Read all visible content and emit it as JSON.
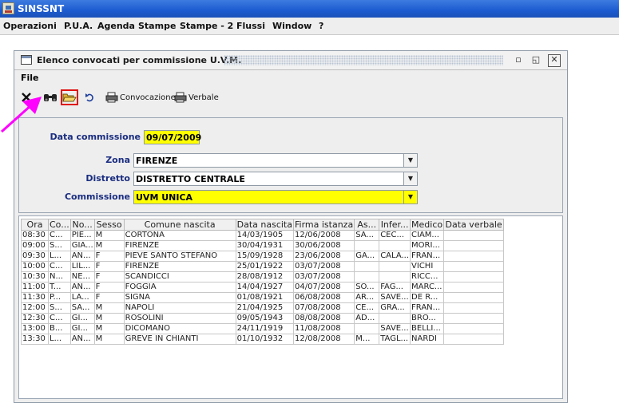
{
  "app": {
    "title": "SINSSNT"
  },
  "menubar": {
    "items": [
      "Operazioni",
      "P.U.A.",
      "Agenda",
      "Stampe",
      "Stampe - 2",
      "Flussi",
      "Window",
      "?"
    ]
  },
  "frame": {
    "title": "Elenco convocati per commissione U.V.M.",
    "menu": "File",
    "toolbar": {
      "convocazione_label": "Convocazione",
      "verbale_label": "Verbale"
    }
  },
  "form": {
    "data_commissione_label": "Data commissione",
    "data_commissione_value": "09/07/2009",
    "zona_label": "Zona",
    "zona_value": "FIRENZE",
    "distretto_label": "Distretto",
    "distretto_value": "DISTRETTO CENTRALE",
    "commissione_label": "Commissione",
    "commissione_value": "UVM UNICA",
    "highlight_color": "#ffff00"
  },
  "table": {
    "columns": [
      "Ora",
      "Co...",
      "No...",
      "Sesso",
      "Comune nascita",
      "Data nascita",
      "Firma istanza",
      "As...",
      "Infer...",
      "Medico",
      "Data verbale"
    ],
    "rows": [
      [
        "08:30",
        "C...",
        "PIE...",
        "M",
        "CORTONA",
        "14/03/1905",
        "12/06/2008",
        "SA...",
        "CEC...",
        "CIAM...",
        ""
      ],
      [
        "09:00",
        "S...",
        "GIA...",
        "M",
        "FIRENZE",
        "30/04/1931",
        "30/06/2008",
        "",
        "",
        "MORI...",
        ""
      ],
      [
        "09:30",
        "L...",
        "AN...",
        "F",
        "PIEVE SANTO STEFANO",
        "15/09/1928",
        "23/06/2008",
        "GA...",
        "CALA...",
        "FRAN...",
        ""
      ],
      [
        "10:00",
        "C...",
        "LIL...",
        "F",
        "FIRENZE",
        "25/01/1922",
        "03/07/2008",
        "",
        "",
        "VICHI",
        ""
      ],
      [
        "10:30",
        "N...",
        "NE...",
        "F",
        "SCANDICCI",
        "28/08/1912",
        "03/07/2008",
        "",
        "",
        "RICC...",
        ""
      ],
      [
        "11:00",
        "T...",
        "AN...",
        "F",
        "FOGGIA",
        "14/04/1927",
        "04/07/2008",
        "SO...",
        "FAG...",
        "MARC...",
        ""
      ],
      [
        "11:30",
        "P...",
        "LA...",
        "F",
        "SIGNA",
        "01/08/1921",
        "06/08/2008",
        "AR...",
        "SAVE...",
        "DE R...",
        ""
      ],
      [
        "12:00",
        "S...",
        "SA...",
        "M",
        "NAPOLI",
        "21/04/1925",
        "07/08/2008",
        "CE...",
        "GRA...",
        "FRAN...",
        ""
      ],
      [
        "12:30",
        "C...",
        "GI...",
        "M",
        "ROSOLINI",
        "09/05/1943",
        "08/08/2008",
        "AD...",
        "",
        "BRO...",
        ""
      ],
      [
        "13:00",
        "B...",
        "GI...",
        "M",
        "DICOMANO",
        "24/11/1919",
        "11/08/2008",
        "",
        "SAVE...",
        "BELLI...",
        ""
      ],
      [
        "13:30",
        "L...",
        "AN...",
        "M",
        "GREVE IN CHIANTI",
        "01/10/1932",
        "12/08/2008",
        "M...",
        "TAGL...",
        "NARDI",
        ""
      ]
    ]
  },
  "annotation": {
    "arrow_color": "#ff00ff"
  }
}
